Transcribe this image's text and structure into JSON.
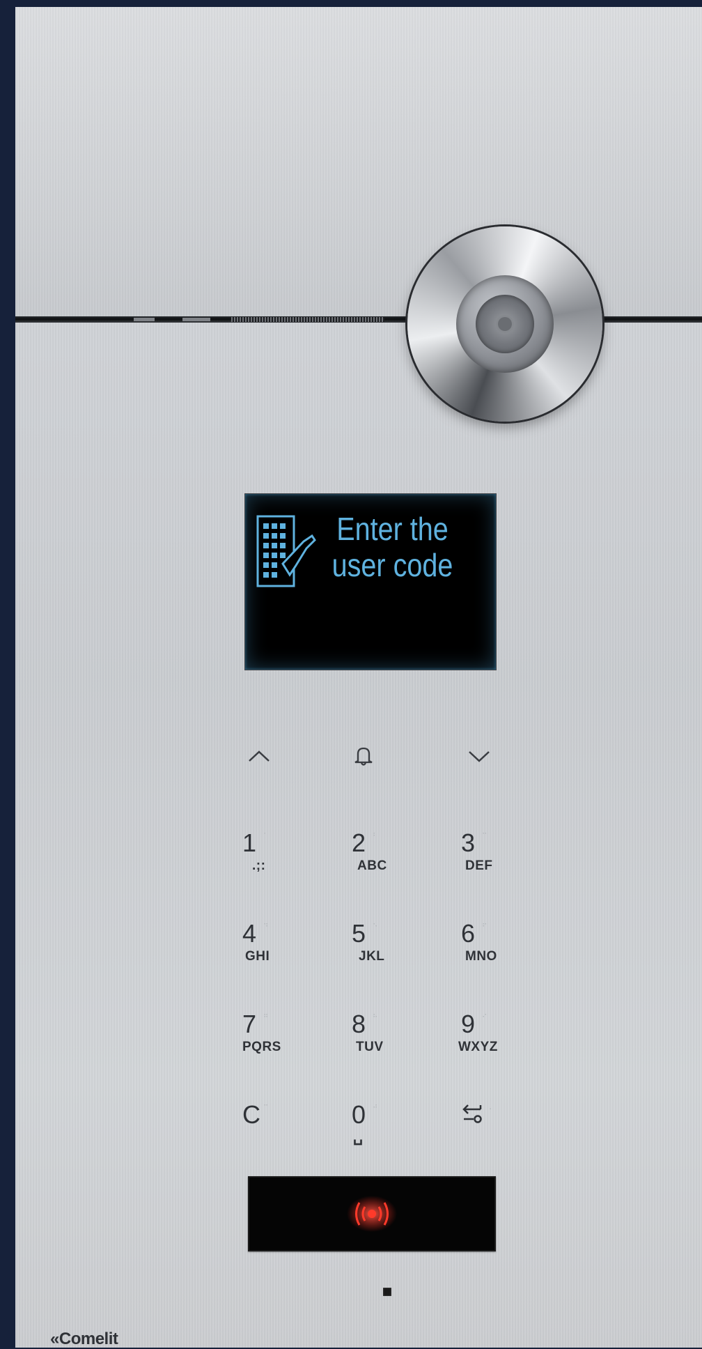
{
  "display": {
    "message": "Enter the user code",
    "icon": "keypad-hand-icon"
  },
  "nav": [
    {
      "name": "up",
      "icon": "chevron-up-icon"
    },
    {
      "name": "call",
      "icon": "bell-icon"
    },
    {
      "name": "down",
      "icon": "chevron-down-icon"
    }
  ],
  "keypad": [
    {
      "digit": "1",
      "letters": ".;:"
    },
    {
      "digit": "2",
      "letters": "ABC"
    },
    {
      "digit": "3",
      "letters": "DEF"
    },
    {
      "digit": "4",
      "letters": "GHI"
    },
    {
      "digit": "5",
      "letters": "JKL"
    },
    {
      "digit": "6",
      "letters": "MNO"
    },
    {
      "digit": "7",
      "letters": "PQRS"
    },
    {
      "digit": "8",
      "letters": "TUV"
    },
    {
      "digit": "9",
      "letters": "WXYZ"
    },
    {
      "digit": "C",
      "letters": ""
    },
    {
      "digit": "0",
      "letters": "␣"
    },
    {
      "digit": "",
      "letters": "",
      "icon": "key-enter-icon"
    }
  ],
  "rfid": {
    "icon": "rfid-reader-icon",
    "color": "#ff2a1f"
  },
  "brand": {
    "name": "Comelit",
    "mark": "«"
  },
  "colors": {
    "screen_text": "#5fb2df",
    "rfid_glow": "#ff2a1f"
  }
}
